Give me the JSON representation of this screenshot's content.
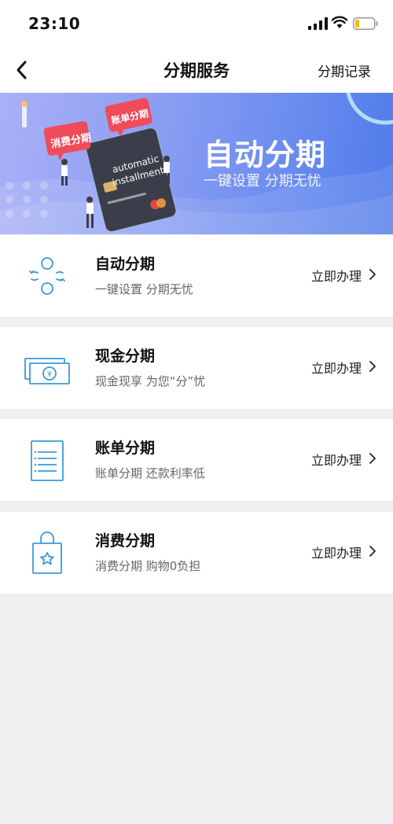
{
  "status_bar": {
    "time": "23:10"
  },
  "nav": {
    "title": "分期服务",
    "right_link": "分期记录"
  },
  "banner": {
    "title": "自动分期",
    "subtitle": "一键设置 分期无忧",
    "tag_left": "消费分期",
    "tag_right": "账单分期",
    "card_text_1": "automatic",
    "card_text_2": "installment"
  },
  "services": [
    {
      "title": "自动分期",
      "subtitle": "一键设置 分期无忧",
      "action": "立即办理",
      "icon": "auto-cycle-icon"
    },
    {
      "title": "现金分期",
      "subtitle": "现金现享 为您“分”忧",
      "action": "立即办理",
      "icon": "cash-bill-icon"
    },
    {
      "title": "账单分期",
      "subtitle": "账单分期 还款利率低",
      "action": "立即办理",
      "icon": "bill-document-icon"
    },
    {
      "title": "消费分期",
      "subtitle": "消费分期 购物0负担",
      "action": "立即办理",
      "icon": "shopping-bag-icon"
    }
  ],
  "colors": {
    "icon_blue": "#3a9ad9",
    "background": "#efeef1"
  }
}
